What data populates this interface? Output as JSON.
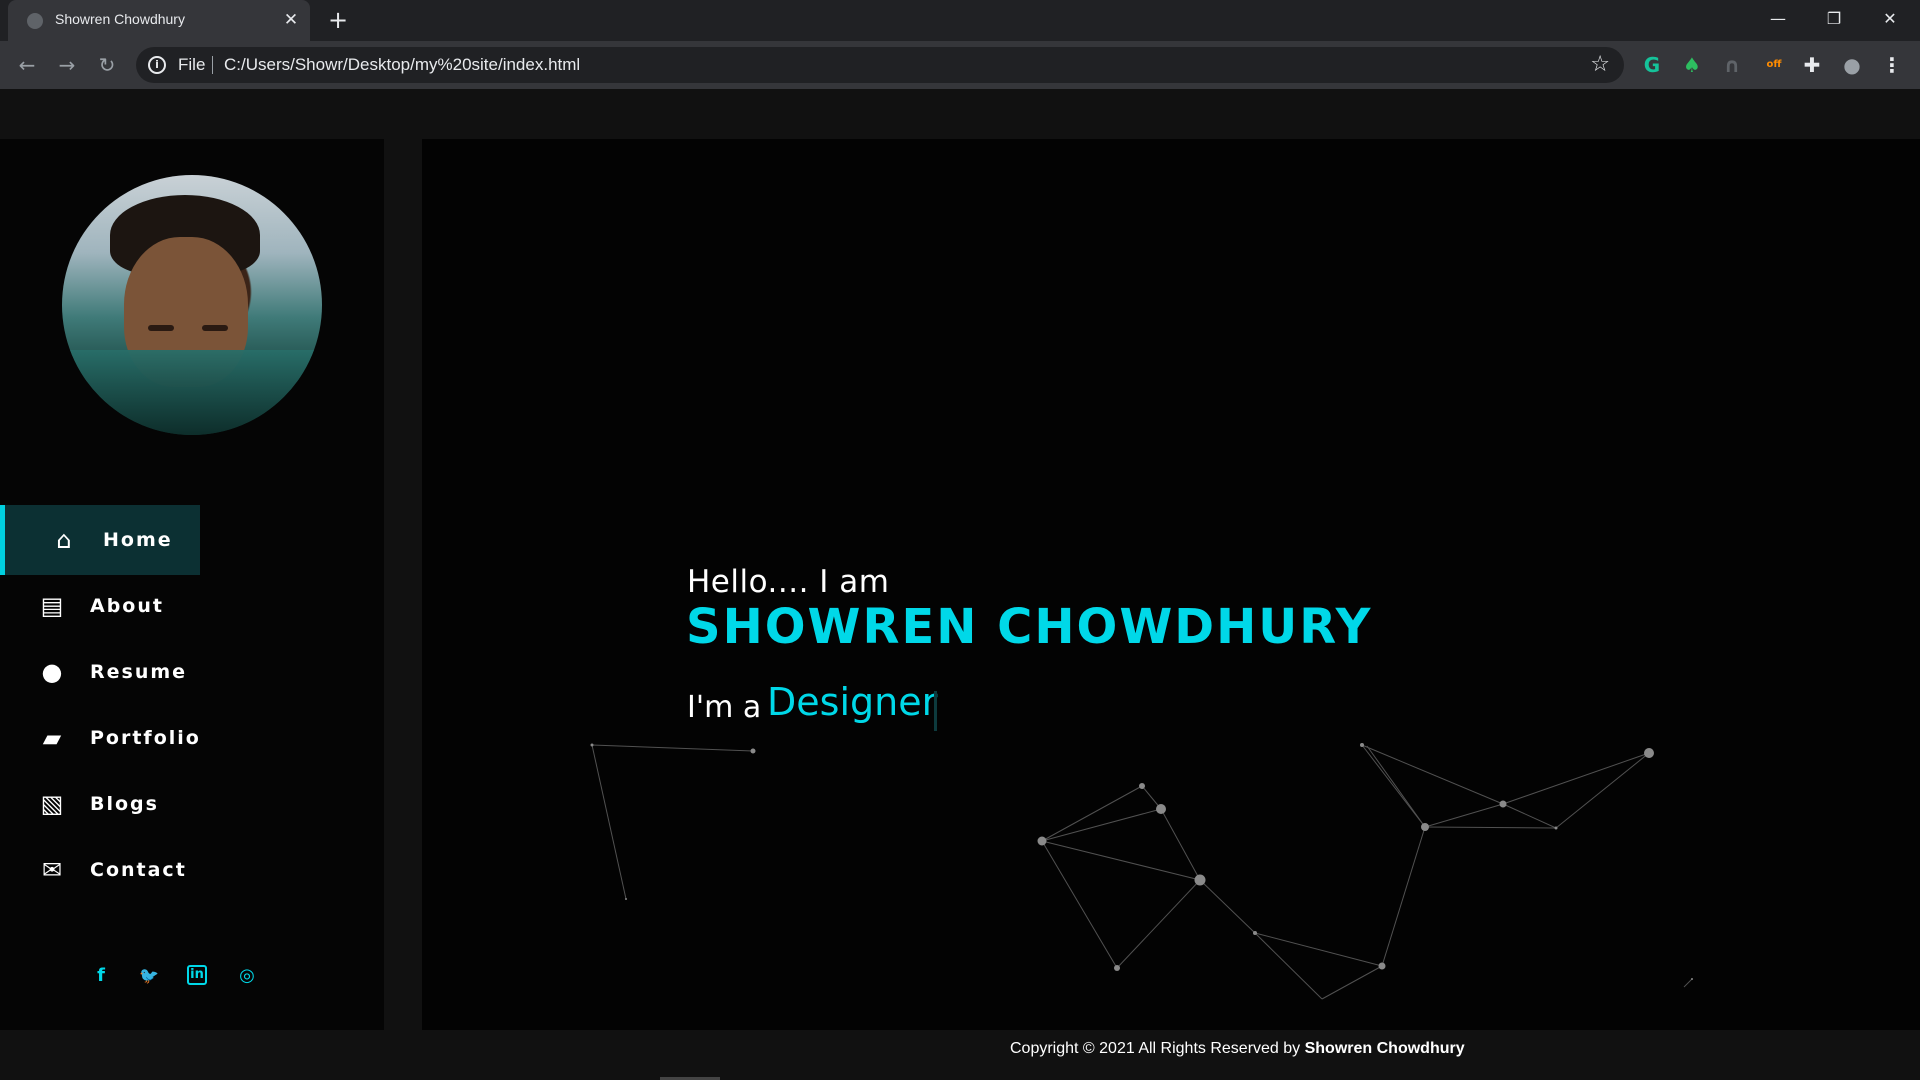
{
  "browser": {
    "tab_title": "Showren Chowdhury",
    "tab_close": "✕",
    "new_tab": "+",
    "minimize": "—",
    "restore": "❐",
    "close": "✕",
    "scheme": "File",
    "url": "C:/Users/Showr/Desktop/my%20site/index.html",
    "back": "←",
    "forward": "→",
    "reload": "↻",
    "bookmark": "☆",
    "extensions": [
      {
        "name": "grammarly",
        "color": "#15c39a",
        "glyph": "G"
      },
      {
        "name": "evernote",
        "color": "#2dbe60",
        "glyph": "♠"
      },
      {
        "name": "arc",
        "color": "#5f6368",
        "glyph": "∩"
      },
      {
        "name": "shop-off",
        "color": "#ff8c00",
        "glyph": "off"
      },
      {
        "name": "puzzle",
        "color": "#e8eaed",
        "glyph": "✚"
      },
      {
        "name": "profile",
        "color": "#9aa0a6",
        "glyph": "●"
      },
      {
        "name": "menu",
        "color": "#e8eaed",
        "glyph": "⋮"
      }
    ]
  },
  "sidebar": {
    "menu": [
      {
        "label": "Home",
        "icon": "⌂",
        "active": true
      },
      {
        "label": "About",
        "icon": "▤",
        "active": false
      },
      {
        "label": "Resume",
        "icon": "●",
        "active": false
      },
      {
        "label": "Portfolio",
        "icon": "▰",
        "active": false
      },
      {
        "label": "Blogs",
        "icon": "▧",
        "active": false
      },
      {
        "label": "Contact",
        "icon": "✉",
        "active": false
      }
    ],
    "socials": [
      {
        "name": "facebook-icon",
        "glyph": "f"
      },
      {
        "name": "twitter-icon",
        "glyph": "🐦"
      },
      {
        "name": "linkedin-icon",
        "glyph": "in"
      },
      {
        "name": "instagram-icon",
        "glyph": "◎"
      }
    ]
  },
  "hero": {
    "greeting": "Hello.... I am",
    "name": "SHOWREN CHOWDHURY",
    "role_prefix": "I'm a",
    "role_word": "Designer"
  },
  "footer": {
    "prefix": "Copyright © 2021 All Rights Reserved by",
    "owner": "Showren Chowdhury"
  },
  "colors": {
    "accent": "#00d8e8",
    "active_bg": "#0c3033"
  }
}
